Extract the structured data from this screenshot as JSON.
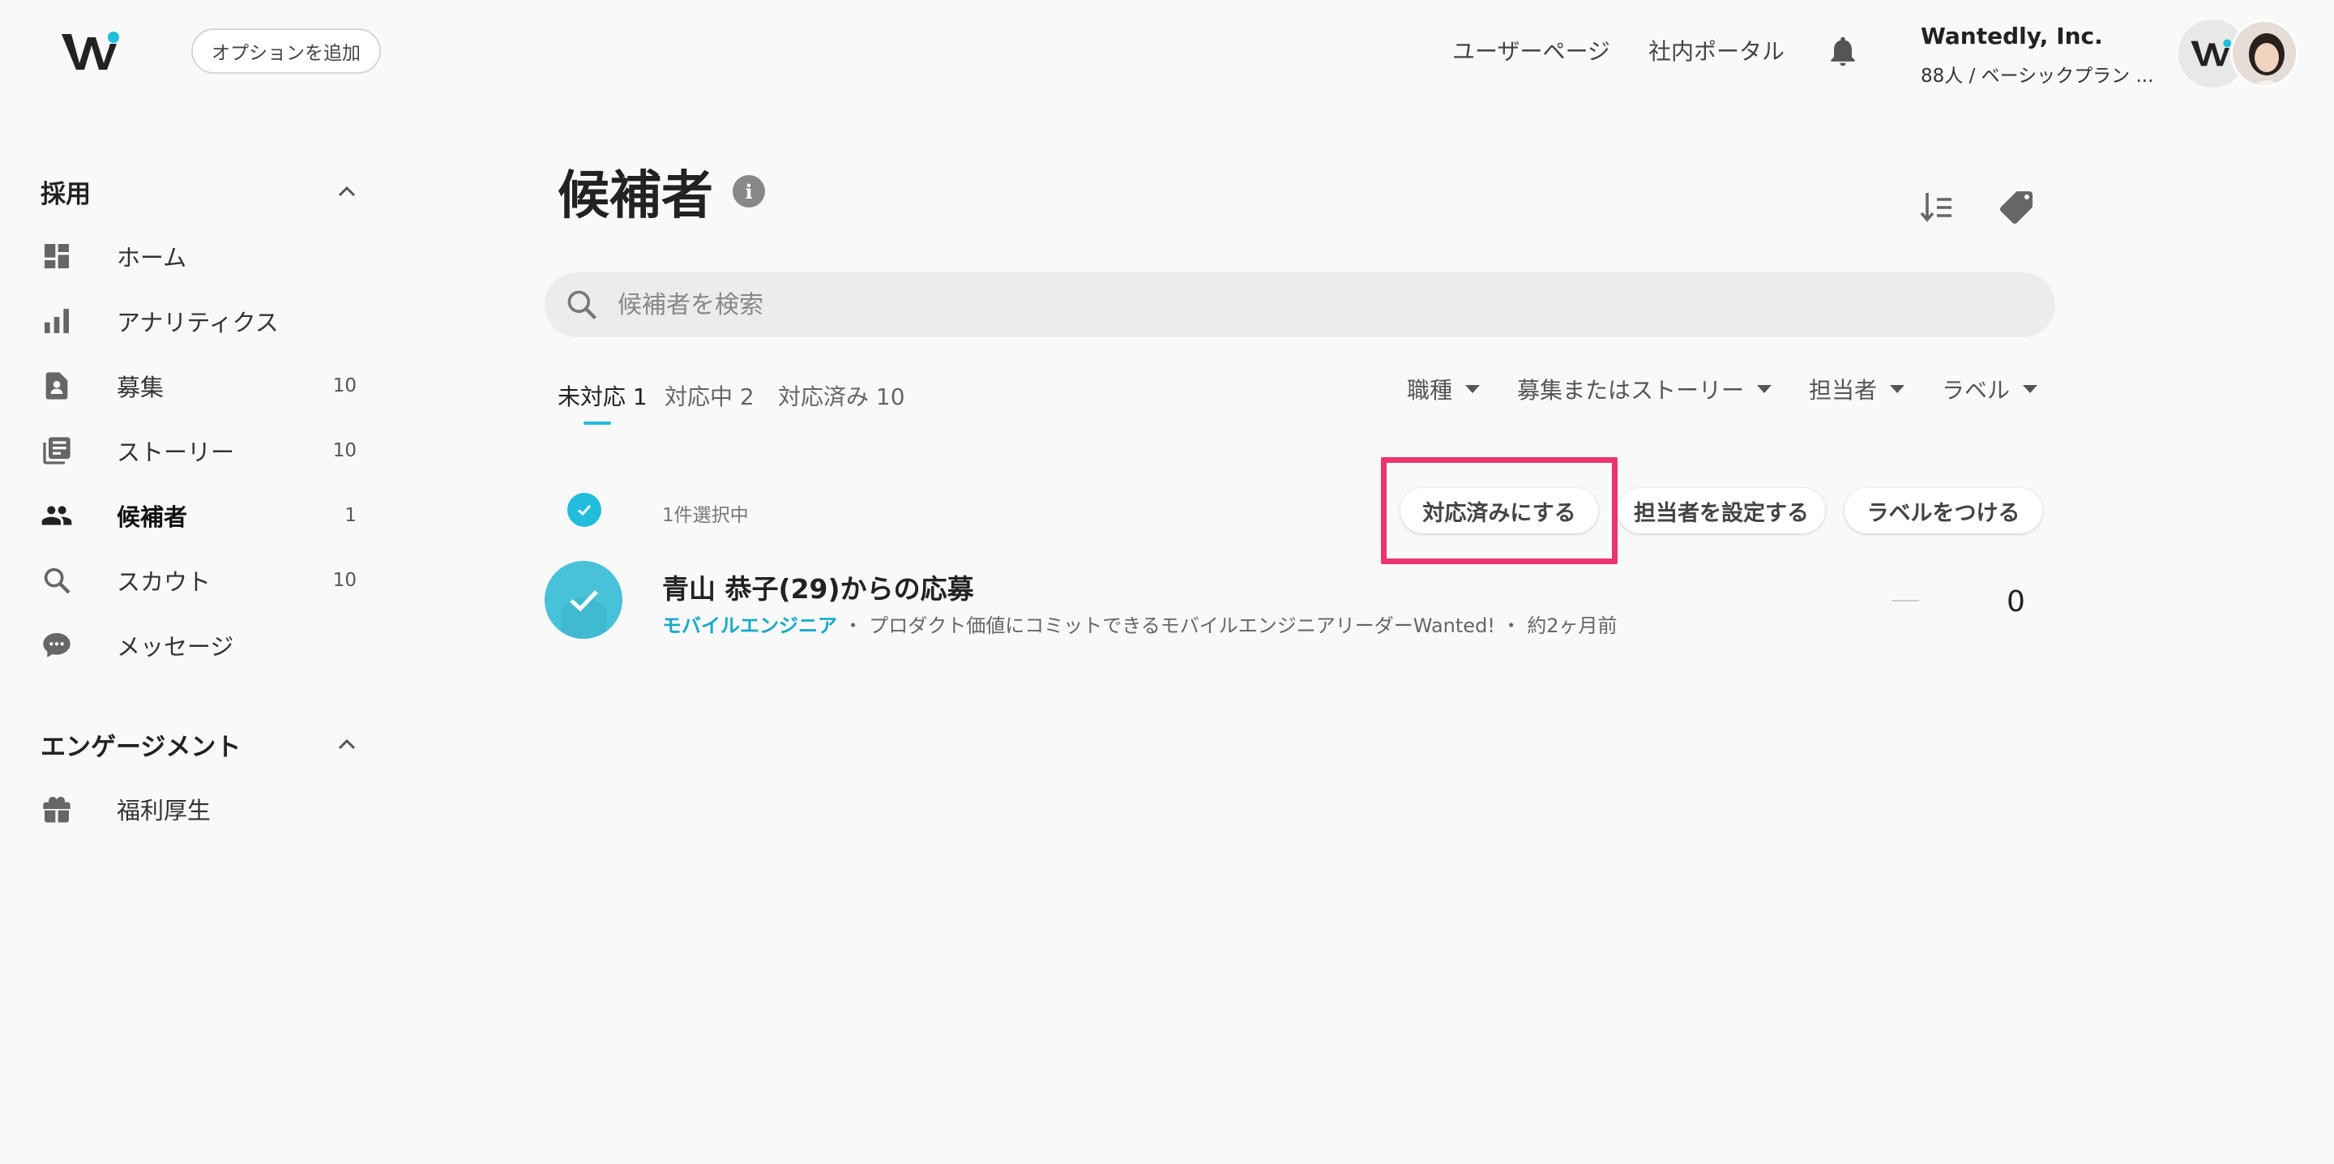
{
  "header": {
    "option_button": "オプションを追加",
    "nav_user_page": "ユーザーページ",
    "nav_portal": "社内ポータル",
    "company_name": "Wantedly, Inc.",
    "plan_text": "88人 / ベーシックプラン ..."
  },
  "sidebar": {
    "section_recruit": "採用",
    "items": [
      {
        "label": "ホーム",
        "count": ""
      },
      {
        "label": "アナリティクス",
        "count": ""
      },
      {
        "label": "募集",
        "count": "10"
      },
      {
        "label": "ストーリー",
        "count": "10"
      },
      {
        "label": "候補者",
        "count": "1"
      },
      {
        "label": "スカウト",
        "count": "10"
      },
      {
        "label": "メッセージ",
        "count": ""
      }
    ],
    "section_engagement": "エンゲージメント",
    "engagement_items": [
      {
        "label": "福利厚生"
      }
    ]
  },
  "main": {
    "title": "候補者",
    "search_placeholder": "候補者を検索",
    "tabs": [
      {
        "label": "未対応 1"
      },
      {
        "label": "対応中 2"
      },
      {
        "label": "対応済み 10"
      }
    ],
    "filters": [
      {
        "label": "職種"
      },
      {
        "label": "募集またはストーリー"
      },
      {
        "label": "担当者"
      },
      {
        "label": "ラベル"
      }
    ],
    "selection_count": "1件選択中",
    "actions": {
      "mark_done": "対応済みにする",
      "set_assignee": "担当者を設定する",
      "add_label": "ラベルをつける"
    },
    "candidate": {
      "name": "青山 恭子(29)からの応募",
      "job": "モバイルエンジニア",
      "separator1": " ・ ",
      "description": "プロダクト価値にコミットできるモバイルエンジニアリーダーWanted!",
      "separator2": " ・ ",
      "time": "約2ヶ月前",
      "dash": "—",
      "number": "0"
    }
  },
  "colors": {
    "accent": "#21bddb",
    "highlight": "#ec3470",
    "background": "#f9f9f9"
  }
}
